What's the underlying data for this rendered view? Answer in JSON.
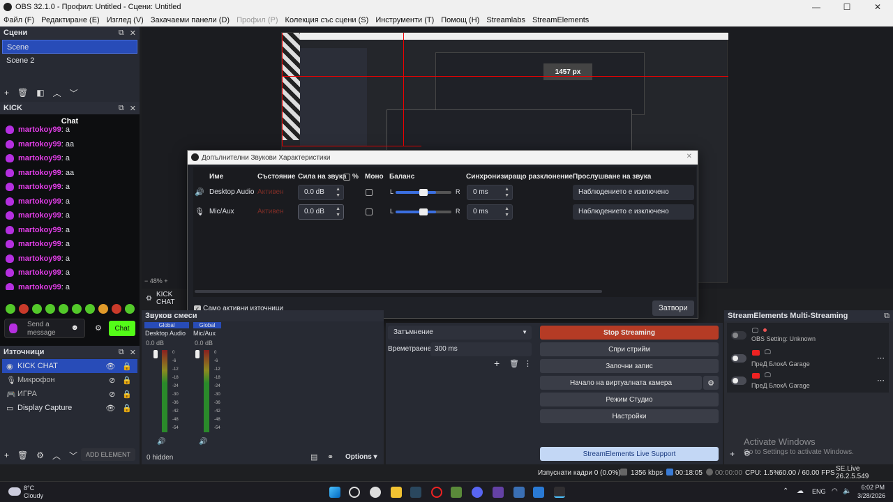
{
  "window": {
    "title": "OBS 32.1.0 - Профил: Untitled - Сцени: Untitled",
    "controls": [
      "—",
      "☐",
      "✕"
    ]
  },
  "menu": [
    {
      "label": "Файл (F)",
      "disabled": false
    },
    {
      "label": "Редактиране (E)",
      "disabled": false
    },
    {
      "label": "Изглед (V)",
      "disabled": false
    },
    {
      "label": "Закачаеми панели (D)",
      "disabled": false
    },
    {
      "label": "Профил (P)",
      "disabled": true
    },
    {
      "label": "Колекция със сцени (S)",
      "disabled": false
    },
    {
      "label": "Инструменти (T)",
      "disabled": false
    },
    {
      "label": "Помощ (H)",
      "disabled": false
    },
    {
      "label": "Streamlabs",
      "disabled": false
    },
    {
      "label": "StreamElements",
      "disabled": false
    }
  ],
  "scenes": {
    "title": "Сцени",
    "items": [
      "Scene",
      "Scene 2"
    ],
    "selected": 0
  },
  "kick": {
    "dock_title": "KICK",
    "chat_title": "Chat",
    "messages": [
      {
        "user": "martokoy99",
        "text": ": a"
      },
      {
        "user": "martokoy99",
        "text": ": aa"
      },
      {
        "user": "martokoy99",
        "text": ": a"
      },
      {
        "user": "martokoy99",
        "text": ": aa"
      },
      {
        "user": "martokoy99",
        "text": ": a"
      },
      {
        "user": "martokoy99",
        "text": ": a"
      },
      {
        "user": "martokoy99",
        "text": ": a"
      },
      {
        "user": "martokoy99",
        "text": ": a"
      },
      {
        "user": "martokoy99",
        "text": ": a"
      },
      {
        "user": "martokoy99",
        "text": ": a"
      },
      {
        "user": "martokoy99",
        "text": ": a"
      },
      {
        "user": "martokoy99",
        "text": ": a"
      }
    ],
    "send_placeholder": "Send a message",
    "chat_button": "Chat"
  },
  "sources": {
    "title": "Източници",
    "items": [
      {
        "label": "KICK CHAT",
        "icon": "browser-icon",
        "selected": true
      },
      {
        "label": "Микрофон",
        "icon": "mic-icon",
        "selected": false
      },
      {
        "label": "ИГРА",
        "icon": "game-icon",
        "selected": false
      },
      {
        "label": "Display Capture",
        "icon": "monitor-icon",
        "selected": false
      }
    ],
    "add_element": "ADD ELEMENT"
  },
  "preview": {
    "zoom": "48%",
    "label": "KICK CHAT",
    "nested_label": "1457 px"
  },
  "dialog": {
    "title": "Допълнителни Звукови Характеристики",
    "headers": {
      "name": "Име",
      "status": "Състояние",
      "volume": "Сила на звука",
      "percent": "%",
      "mono": "Моно",
      "balance": "Баланс",
      "sync": "Синхронизиращо разклонение",
      "monitor": "Прослушване на звука"
    },
    "rows": [
      {
        "name": "Desktop Audio",
        "icon": "speaker-icon",
        "status": "Активен",
        "volume": "0.0 dB",
        "balance_l": "L",
        "balance_r": "R",
        "balance": 0.5,
        "sync": "0 ms",
        "monitor": "Наблюдението е изключено"
      },
      {
        "name": "Mic/Aux",
        "icon": "mic-icon",
        "status": "Активен",
        "volume": "0.0 dB",
        "balance_l": "L",
        "balance_r": "R",
        "balance": 0.5,
        "sync": "0 ms",
        "monitor": "Наблюдението е изключено"
      }
    ],
    "only_active": "Само активни източници",
    "close": "Затвори"
  },
  "mixer": {
    "title": "Звуков смеси",
    "channels": [
      {
        "badge": "Global",
        "name": "Desktop Audio",
        "level": "0.0 dB"
      },
      {
        "badge": "Global",
        "name": "Mic/Aux",
        "level": "0.0 dB"
      }
    ],
    "scale": [
      "0",
      "-6",
      "-12",
      "-18",
      "-24",
      "-30",
      "-36",
      "-42",
      "-48",
      "-54",
      "-60"
    ],
    "hidden": "0 hidden",
    "options": "Options"
  },
  "transitions": {
    "type": "Затъмнение",
    "duration_label": "Времетраене",
    "duration": "300 ms"
  },
  "controls": {
    "stop_streaming": "Stop Streaming",
    "stop_stream_bg": "Спри стрийм",
    "start_recording": "Започни запис",
    "virtual_camera": "Начало на виртуалната камера",
    "studio_mode": "Режим Студио",
    "settings": "Настройки",
    "live_support": "StreamElements Live Support"
  },
  "multistream": {
    "title": "StreamElements Multi-Streaming",
    "items": [
      {
        "label": "OBS Setting: Unknown"
      },
      {
        "label": "ПреД БлокА Garage"
      },
      {
        "label": "ПреД БлокА Garage"
      }
    ]
  },
  "watermark": {
    "line1": "Activate Windows",
    "line2": "Go to Settings to activate Windows."
  },
  "status": {
    "dropped": "Изпуснати кадри 0 (0.0%)",
    "bitrate": "1356 kbps",
    "stream_time": "00:18:05",
    "rec_time": "00:00:00",
    "cpu": "CPU: 1.5%",
    "fps": "60.00 / 60.00 FPS",
    "version": "SE.Live 26.2.5.549"
  },
  "taskbar": {
    "temp": "8°C",
    "weather": "Cloudy",
    "lang": "ENG",
    "time": "6:02 PM",
    "date": "3/28/2026"
  }
}
